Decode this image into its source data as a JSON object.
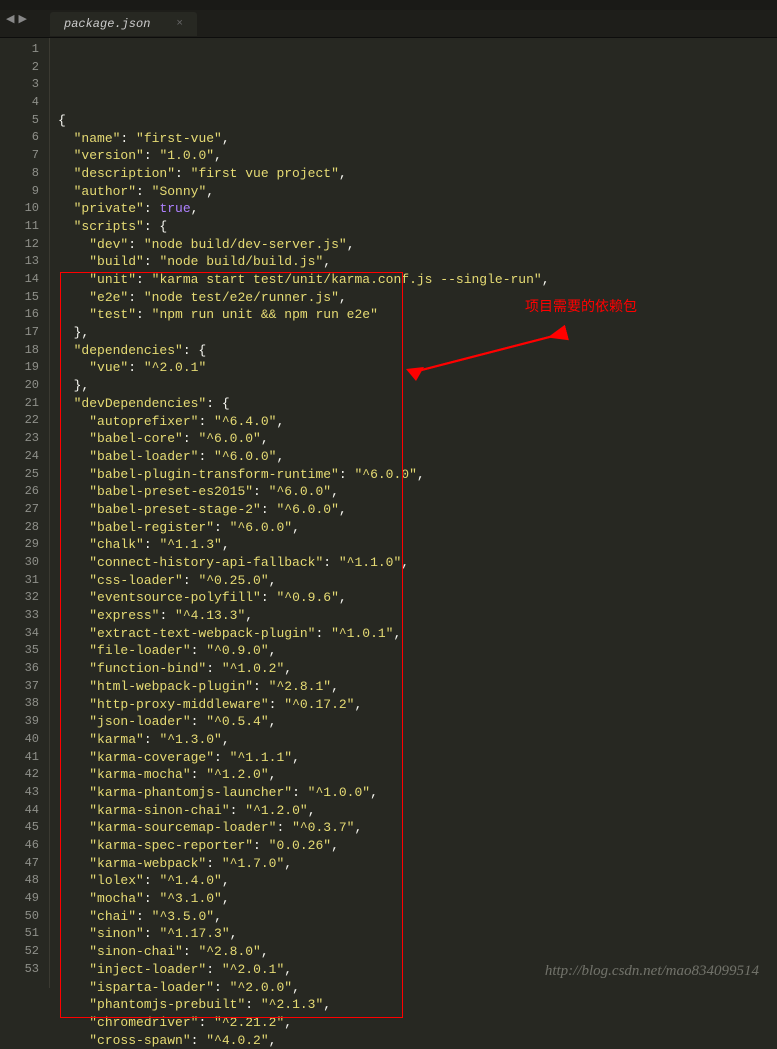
{
  "tab": {
    "filename": "package.json"
  },
  "nav": {
    "back": "◀",
    "forward": "▶"
  },
  "annotation": {
    "text": "项目需要的依赖包"
  },
  "watermark": "http://blog.csdn.net/mao834099514",
  "lines": [
    {
      "n": "1",
      "tokens": [
        [
          "p",
          "{"
        ]
      ]
    },
    {
      "n": "2",
      "tokens": [
        [
          "p",
          "  "
        ],
        [
          "s",
          "\"name\""
        ],
        [
          "p",
          ": "
        ],
        [
          "s",
          "\"first-vue\""
        ],
        [
          "p",
          ","
        ]
      ]
    },
    {
      "n": "3",
      "tokens": [
        [
          "p",
          "  "
        ],
        [
          "s",
          "\"version\""
        ],
        [
          "p",
          ": "
        ],
        [
          "s",
          "\"1.0.0\""
        ],
        [
          "p",
          ","
        ]
      ]
    },
    {
      "n": "4",
      "tokens": [
        [
          "p",
          "  "
        ],
        [
          "s",
          "\"description\""
        ],
        [
          "p",
          ": "
        ],
        [
          "s",
          "\"first vue project\""
        ],
        [
          "p",
          ","
        ]
      ]
    },
    {
      "n": "5",
      "tokens": [
        [
          "p",
          "  "
        ],
        [
          "s",
          "\"author\""
        ],
        [
          "p",
          ": "
        ],
        [
          "s",
          "\"Sonny\""
        ],
        [
          "p",
          ","
        ]
      ]
    },
    {
      "n": "6",
      "tokens": [
        [
          "p",
          "  "
        ],
        [
          "s",
          "\"private\""
        ],
        [
          "p",
          ": "
        ],
        [
          "bool",
          "true"
        ],
        [
          "p",
          ","
        ]
      ]
    },
    {
      "n": "7",
      "tokens": [
        [
          "p",
          "  "
        ],
        [
          "s",
          "\"scripts\""
        ],
        [
          "p",
          ": {"
        ]
      ]
    },
    {
      "n": "8",
      "tokens": [
        [
          "p",
          "    "
        ],
        [
          "s",
          "\"dev\""
        ],
        [
          "p",
          ": "
        ],
        [
          "s",
          "\"node build/dev-server.js\""
        ],
        [
          "p",
          ","
        ]
      ]
    },
    {
      "n": "9",
      "tokens": [
        [
          "p",
          "    "
        ],
        [
          "s",
          "\"build\""
        ],
        [
          "p",
          ": "
        ],
        [
          "s",
          "\"node build/build.js\""
        ],
        [
          "p",
          ","
        ]
      ]
    },
    {
      "n": "10",
      "tokens": [
        [
          "p",
          "    "
        ],
        [
          "s",
          "\"unit\""
        ],
        [
          "p",
          ": "
        ],
        [
          "s",
          "\"karma start test/unit/karma.conf.js --single-run\""
        ],
        [
          "p",
          ","
        ]
      ]
    },
    {
      "n": "11",
      "tokens": [
        [
          "p",
          "    "
        ],
        [
          "s",
          "\"e2e\""
        ],
        [
          "p",
          ": "
        ],
        [
          "s",
          "\"node test/e2e/runner.js\""
        ],
        [
          "p",
          ","
        ]
      ]
    },
    {
      "n": "12",
      "tokens": [
        [
          "p",
          "    "
        ],
        [
          "s",
          "\"test\""
        ],
        [
          "p",
          ": "
        ],
        [
          "s",
          "\"npm run unit && npm run e2e\""
        ]
      ]
    },
    {
      "n": "13",
      "tokens": [
        [
          "p",
          "  },"
        ]
      ]
    },
    {
      "n": "14",
      "tokens": [
        [
          "p",
          "  "
        ],
        [
          "s",
          "\"dependencies\""
        ],
        [
          "p",
          ": {"
        ]
      ]
    },
    {
      "n": "15",
      "tokens": [
        [
          "p",
          "    "
        ],
        [
          "s",
          "\"vue\""
        ],
        [
          "p",
          ": "
        ],
        [
          "s",
          "\"^2.0.1\""
        ]
      ]
    },
    {
      "n": "16",
      "tokens": [
        [
          "p",
          "  },"
        ]
      ]
    },
    {
      "n": "17",
      "tokens": [
        [
          "p",
          "  "
        ],
        [
          "s",
          "\"devDependencies\""
        ],
        [
          "p",
          ": {"
        ]
      ]
    },
    {
      "n": "18",
      "tokens": [
        [
          "p",
          "    "
        ],
        [
          "s",
          "\"autoprefixer\""
        ],
        [
          "p",
          ": "
        ],
        [
          "s",
          "\"^6.4.0\""
        ],
        [
          "p",
          ","
        ]
      ]
    },
    {
      "n": "19",
      "tokens": [
        [
          "p",
          "    "
        ],
        [
          "s",
          "\"babel-core\""
        ],
        [
          "p",
          ": "
        ],
        [
          "s",
          "\"^6.0.0\""
        ],
        [
          "p",
          ","
        ]
      ]
    },
    {
      "n": "20",
      "tokens": [
        [
          "p",
          "    "
        ],
        [
          "s",
          "\"babel-loader\""
        ],
        [
          "p",
          ": "
        ],
        [
          "s",
          "\"^6.0.0\""
        ],
        [
          "p",
          ","
        ]
      ]
    },
    {
      "n": "21",
      "tokens": [
        [
          "p",
          "    "
        ],
        [
          "s",
          "\"babel-plugin-transform-runtime\""
        ],
        [
          "p",
          ": "
        ],
        [
          "s",
          "\"^6.0.0\""
        ],
        [
          "p",
          ","
        ]
      ]
    },
    {
      "n": "22",
      "tokens": [
        [
          "p",
          "    "
        ],
        [
          "s",
          "\"babel-preset-es2015\""
        ],
        [
          "p",
          ": "
        ],
        [
          "s",
          "\"^6.0.0\""
        ],
        [
          "p",
          ","
        ]
      ]
    },
    {
      "n": "23",
      "tokens": [
        [
          "p",
          "    "
        ],
        [
          "s",
          "\"babel-preset-stage-2\""
        ],
        [
          "p",
          ": "
        ],
        [
          "s",
          "\"^6.0.0\""
        ],
        [
          "p",
          ","
        ]
      ]
    },
    {
      "n": "24",
      "tokens": [
        [
          "p",
          "    "
        ],
        [
          "s",
          "\"babel-register\""
        ],
        [
          "p",
          ": "
        ],
        [
          "s",
          "\"^6.0.0\""
        ],
        [
          "p",
          ","
        ]
      ]
    },
    {
      "n": "25",
      "tokens": [
        [
          "p",
          "    "
        ],
        [
          "s",
          "\"chalk\""
        ],
        [
          "p",
          ": "
        ],
        [
          "s",
          "\"^1.1.3\""
        ],
        [
          "p",
          ","
        ]
      ]
    },
    {
      "n": "26",
      "tokens": [
        [
          "p",
          "    "
        ],
        [
          "s",
          "\"connect-history-api-fallback\""
        ],
        [
          "p",
          ": "
        ],
        [
          "s",
          "\"^1.1.0\""
        ],
        [
          "p",
          ","
        ]
      ]
    },
    {
      "n": "27",
      "tokens": [
        [
          "p",
          "    "
        ],
        [
          "s",
          "\"css-loader\""
        ],
        [
          "p",
          ": "
        ],
        [
          "s",
          "\"^0.25.0\""
        ],
        [
          "p",
          ","
        ]
      ]
    },
    {
      "n": "28",
      "tokens": [
        [
          "p",
          "    "
        ],
        [
          "s",
          "\"eventsource-polyfill\""
        ],
        [
          "p",
          ": "
        ],
        [
          "s",
          "\"^0.9.6\""
        ],
        [
          "p",
          ","
        ]
      ]
    },
    {
      "n": "29",
      "tokens": [
        [
          "p",
          "    "
        ],
        [
          "s",
          "\"express\""
        ],
        [
          "p",
          ": "
        ],
        [
          "s",
          "\"^4.13.3\""
        ],
        [
          "p",
          ","
        ]
      ]
    },
    {
      "n": "30",
      "tokens": [
        [
          "p",
          "    "
        ],
        [
          "s",
          "\"extract-text-webpack-plugin\""
        ],
        [
          "p",
          ": "
        ],
        [
          "s",
          "\"^1.0.1\""
        ],
        [
          "p",
          ","
        ]
      ]
    },
    {
      "n": "31",
      "tokens": [
        [
          "p",
          "    "
        ],
        [
          "s",
          "\"file-loader\""
        ],
        [
          "p",
          ": "
        ],
        [
          "s",
          "\"^0.9.0\""
        ],
        [
          "p",
          ","
        ]
      ]
    },
    {
      "n": "32",
      "tokens": [
        [
          "p",
          "    "
        ],
        [
          "s",
          "\"function-bind\""
        ],
        [
          "p",
          ": "
        ],
        [
          "s",
          "\"^1.0.2\""
        ],
        [
          "p",
          ","
        ]
      ]
    },
    {
      "n": "33",
      "tokens": [
        [
          "p",
          "    "
        ],
        [
          "s",
          "\"html-webpack-plugin\""
        ],
        [
          "p",
          ": "
        ],
        [
          "s",
          "\"^2.8.1\""
        ],
        [
          "p",
          ","
        ]
      ]
    },
    {
      "n": "34",
      "tokens": [
        [
          "p",
          "    "
        ],
        [
          "s",
          "\"http-proxy-middleware\""
        ],
        [
          "p",
          ": "
        ],
        [
          "s",
          "\"^0.17.2\""
        ],
        [
          "p",
          ","
        ]
      ]
    },
    {
      "n": "35",
      "tokens": [
        [
          "p",
          "    "
        ],
        [
          "s",
          "\"json-loader\""
        ],
        [
          "p",
          ": "
        ],
        [
          "s",
          "\"^0.5.4\""
        ],
        [
          "p",
          ","
        ]
      ]
    },
    {
      "n": "36",
      "tokens": [
        [
          "p",
          "    "
        ],
        [
          "s",
          "\"karma\""
        ],
        [
          "p",
          ": "
        ],
        [
          "s",
          "\"^1.3.0\""
        ],
        [
          "p",
          ","
        ]
      ]
    },
    {
      "n": "37",
      "tokens": [
        [
          "p",
          "    "
        ],
        [
          "s",
          "\"karma-coverage\""
        ],
        [
          "p",
          ": "
        ],
        [
          "s",
          "\"^1.1.1\""
        ],
        [
          "p",
          ","
        ]
      ]
    },
    {
      "n": "38",
      "tokens": [
        [
          "p",
          "    "
        ],
        [
          "s",
          "\"karma-mocha\""
        ],
        [
          "p",
          ": "
        ],
        [
          "s",
          "\"^1.2.0\""
        ],
        [
          "p",
          ","
        ]
      ]
    },
    {
      "n": "39",
      "tokens": [
        [
          "p",
          "    "
        ],
        [
          "s",
          "\"karma-phantomjs-launcher\""
        ],
        [
          "p",
          ": "
        ],
        [
          "s",
          "\"^1.0.0\""
        ],
        [
          "p",
          ","
        ]
      ]
    },
    {
      "n": "40",
      "tokens": [
        [
          "p",
          "    "
        ],
        [
          "s",
          "\"karma-sinon-chai\""
        ],
        [
          "p",
          ": "
        ],
        [
          "s",
          "\"^1.2.0\""
        ],
        [
          "p",
          ","
        ]
      ]
    },
    {
      "n": "41",
      "tokens": [
        [
          "p",
          "    "
        ],
        [
          "s",
          "\"karma-sourcemap-loader\""
        ],
        [
          "p",
          ": "
        ],
        [
          "s",
          "\"^0.3.7\""
        ],
        [
          "p",
          ","
        ]
      ]
    },
    {
      "n": "42",
      "tokens": [
        [
          "p",
          "    "
        ],
        [
          "s",
          "\"karma-spec-reporter\""
        ],
        [
          "p",
          ": "
        ],
        [
          "s",
          "\"0.0.26\""
        ],
        [
          "p",
          ","
        ]
      ]
    },
    {
      "n": "43",
      "tokens": [
        [
          "p",
          "    "
        ],
        [
          "s",
          "\"karma-webpack\""
        ],
        [
          "p",
          ": "
        ],
        [
          "s",
          "\"^1.7.0\""
        ],
        [
          "p",
          ","
        ]
      ]
    },
    {
      "n": "44",
      "tokens": [
        [
          "p",
          "    "
        ],
        [
          "s",
          "\"lolex\""
        ],
        [
          "p",
          ": "
        ],
        [
          "s",
          "\"^1.4.0\""
        ],
        [
          "p",
          ","
        ]
      ]
    },
    {
      "n": "45",
      "tokens": [
        [
          "p",
          "    "
        ],
        [
          "s",
          "\"mocha\""
        ],
        [
          "p",
          ": "
        ],
        [
          "s",
          "\"^3.1.0\""
        ],
        [
          "p",
          ","
        ]
      ]
    },
    {
      "n": "46",
      "tokens": [
        [
          "p",
          "    "
        ],
        [
          "s",
          "\"chai\""
        ],
        [
          "p",
          ": "
        ],
        [
          "s",
          "\"^3.5.0\""
        ],
        [
          "p",
          ","
        ]
      ]
    },
    {
      "n": "47",
      "tokens": [
        [
          "p",
          "    "
        ],
        [
          "s",
          "\"sinon\""
        ],
        [
          "p",
          ": "
        ],
        [
          "s",
          "\"^1.17.3\""
        ],
        [
          "p",
          ","
        ]
      ]
    },
    {
      "n": "48",
      "tokens": [
        [
          "p",
          "    "
        ],
        [
          "s",
          "\"sinon-chai\""
        ],
        [
          "p",
          ": "
        ],
        [
          "s",
          "\"^2.8.0\""
        ],
        [
          "p",
          ","
        ]
      ]
    },
    {
      "n": "49",
      "tokens": [
        [
          "p",
          "    "
        ],
        [
          "s",
          "\"inject-loader\""
        ],
        [
          "p",
          ": "
        ],
        [
          "s",
          "\"^2.0.1\""
        ],
        [
          "p",
          ","
        ]
      ]
    },
    {
      "n": "50",
      "tokens": [
        [
          "p",
          "    "
        ],
        [
          "s",
          "\"isparta-loader\""
        ],
        [
          "p",
          ": "
        ],
        [
          "s",
          "\"^2.0.0\""
        ],
        [
          "p",
          ","
        ]
      ]
    },
    {
      "n": "51",
      "tokens": [
        [
          "p",
          "    "
        ],
        [
          "s",
          "\"phantomjs-prebuilt\""
        ],
        [
          "p",
          ": "
        ],
        [
          "s",
          "\"^2.1.3\""
        ],
        [
          "p",
          ","
        ]
      ]
    },
    {
      "n": "52",
      "tokens": [
        [
          "p",
          "    "
        ],
        [
          "s",
          "\"chromedriver\""
        ],
        [
          "p",
          ": "
        ],
        [
          "s",
          "\"^2.21.2\""
        ],
        [
          "p",
          ","
        ]
      ]
    },
    {
      "n": "53",
      "tokens": [
        [
          "p",
          "    "
        ],
        [
          "s",
          "\"cross-spawn\""
        ],
        [
          "p",
          ": "
        ],
        [
          "s",
          "\"^4.0.2\""
        ],
        [
          "p",
          ","
        ]
      ]
    }
  ]
}
